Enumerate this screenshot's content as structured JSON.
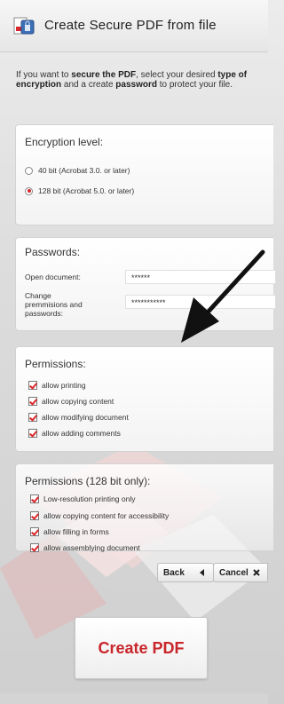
{
  "header": {
    "title": "Create Secure PDF from file",
    "icon": "pdf-lock-icon"
  },
  "intro": {
    "p1": "If you want to ",
    "b1": "secure the PDF",
    "p2": ", select your desired ",
    "b2": "type of encryption",
    "p3": " and a create ",
    "b3": "password",
    "p4": " to protect your file."
  },
  "encryption": {
    "title": "Encryption level:",
    "options": [
      {
        "label": "40 bit (Acrobat 3.0. or later)",
        "selected": false
      },
      {
        "label": "128 bit (Acrobat 5.0. or later)",
        "selected": true
      }
    ]
  },
  "passwords": {
    "title": "Passwords:",
    "open_label": "Open document:",
    "open_value": "******",
    "change_label": "Change\npremmisions and\npasswords:",
    "change_value": "***********"
  },
  "permissions": {
    "title": "Permissions:",
    "items": [
      "allow printing",
      "allow copying content",
      "allow modifying document",
      "allow adding comments"
    ]
  },
  "permissions128": {
    "title": "Permissions (128 bit only):",
    "items": [
      "Low-resolution printing only",
      "allow copying content for accessibility",
      "allow filling in forms",
      "allow assemblying document"
    ]
  },
  "buttons": {
    "back": "Back",
    "cancel": "Cancel",
    "create": "Create PDF"
  },
  "colors": {
    "accent": "#d9262c",
    "arrow": "#111111"
  }
}
